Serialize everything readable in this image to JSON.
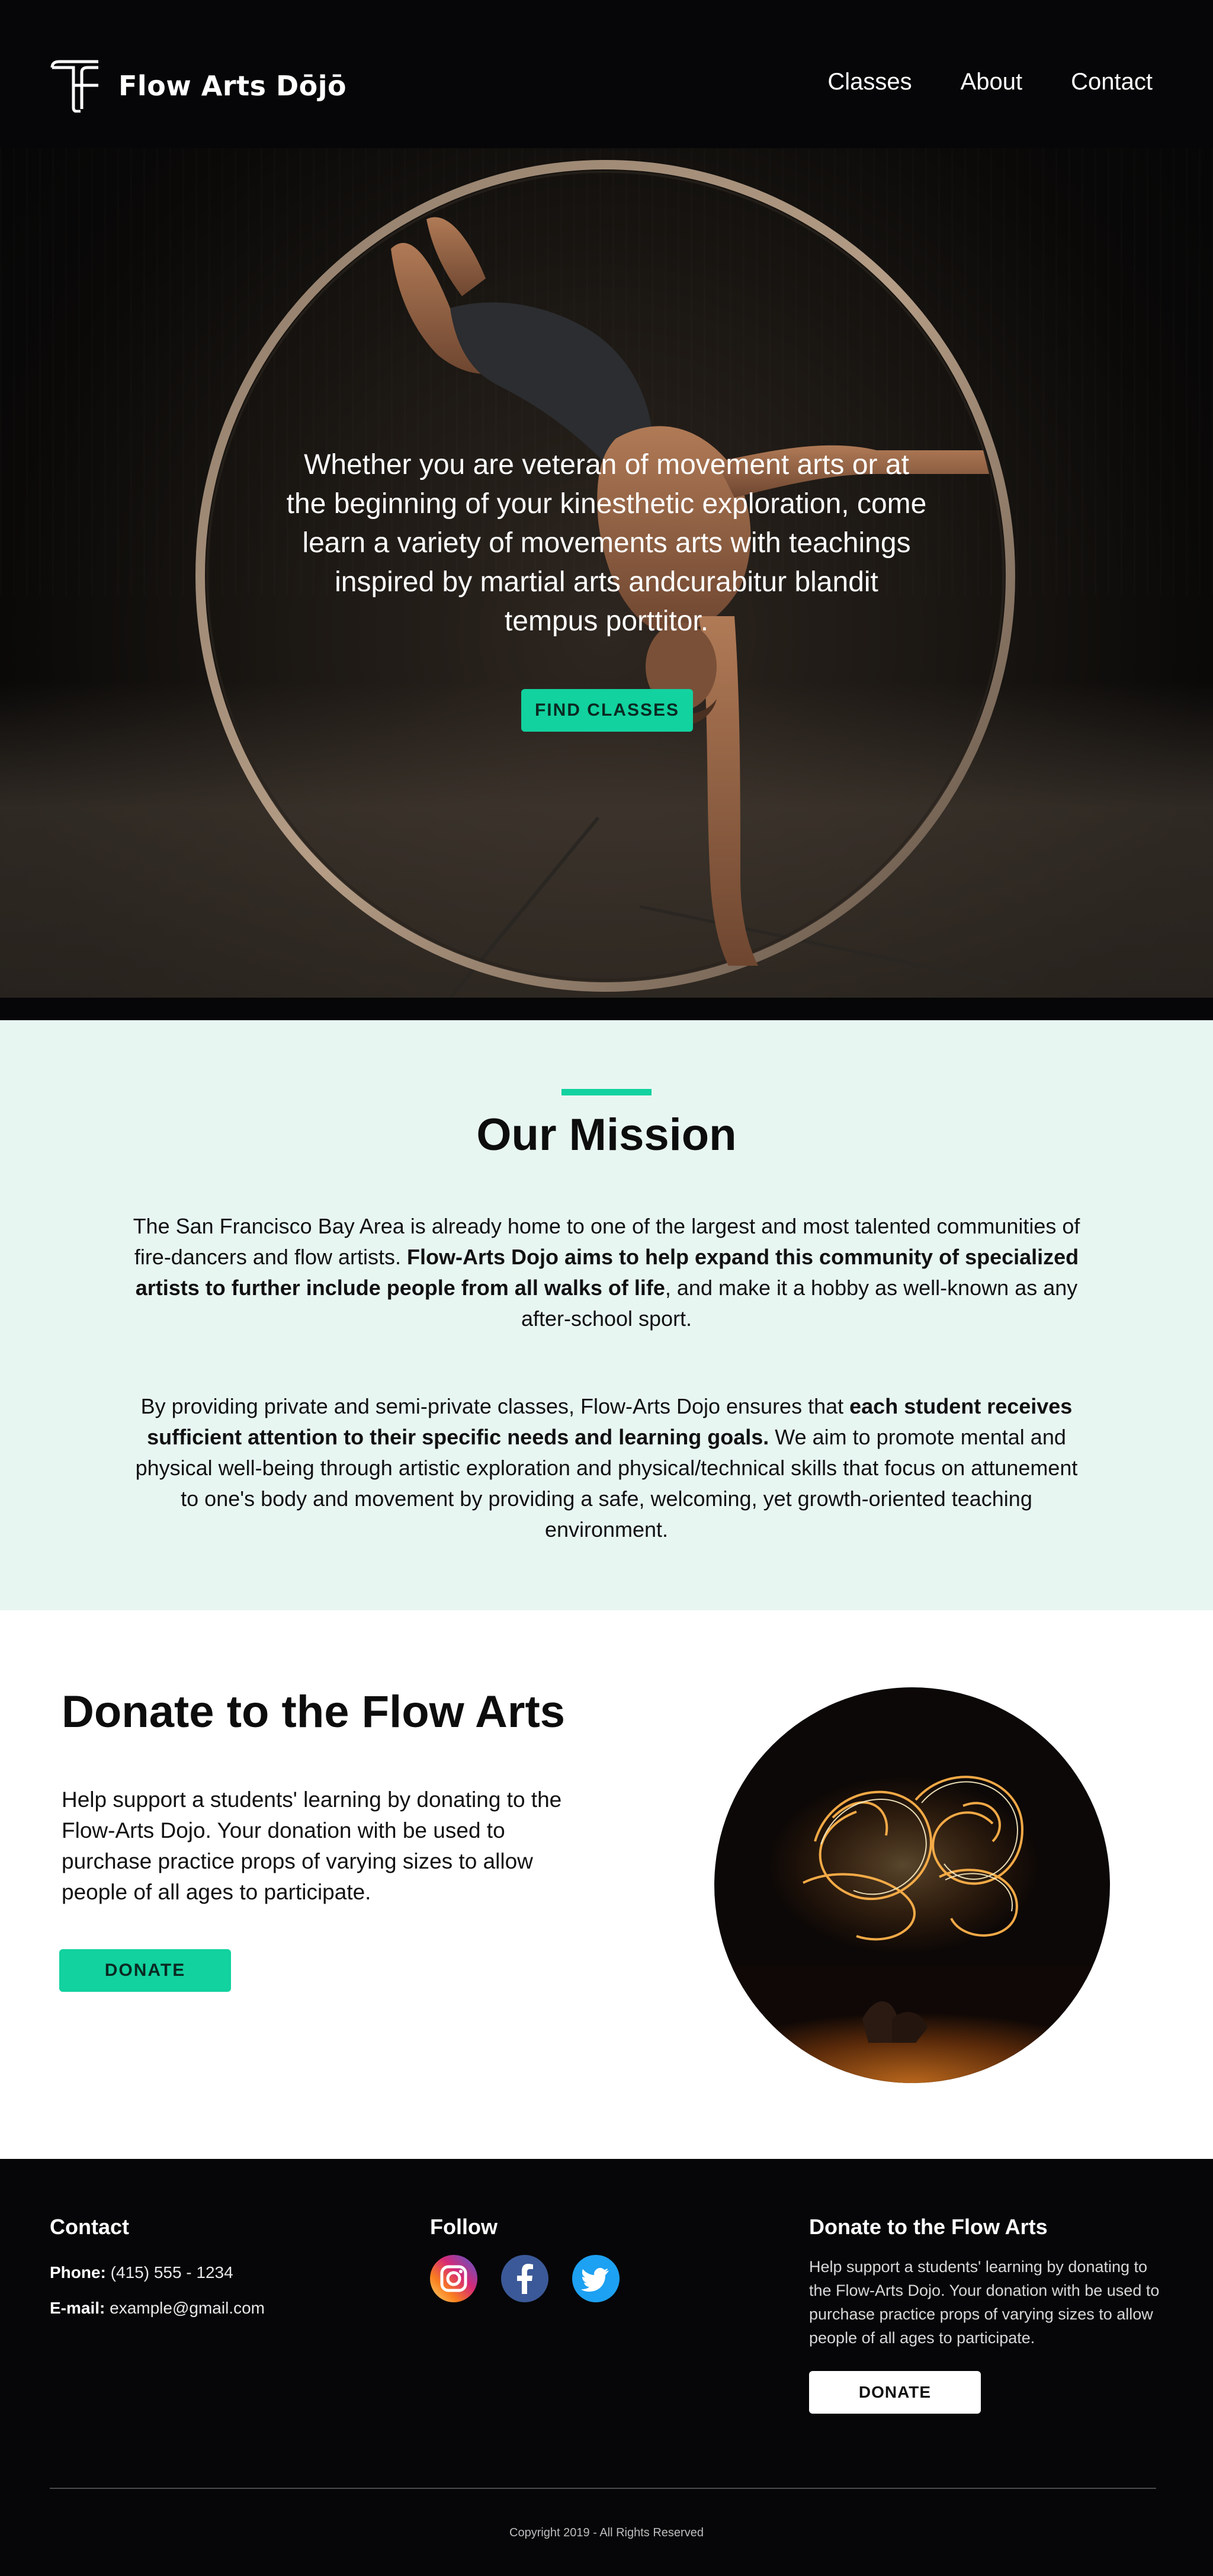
{
  "header": {
    "brand": "Flow Arts Dōjō",
    "nav": [
      "Classes",
      "About",
      "Contact"
    ]
  },
  "hero": {
    "tagline": "Whether you are veteran of movement arts or at the beginning of your kinesthetic exploration, come learn a variety of movements arts with teachings inspired by martial arts andcurabitur blandit tempus porttitor.",
    "cta_label": "FIND CLASSES"
  },
  "mission": {
    "title": "Our Mission",
    "p1_a": "The San Francisco Bay Area is already home to one of the largest and most talented communities of fire-dancers and flow artists. ",
    "p1_b": "Flow-Arts Dojo aims to help expand this community of specialized artists to further include people from all walks of life",
    "p1_c": ", and make it a hobby as well-known as any after-school sport.",
    "p2_a": "By providing private and semi-private classes, Flow-Arts Dojo ensures that ",
    "p2_b": "each student receives sufficient attention to their specific needs and learning goals.",
    "p2_c": " We aim to promote mental and physical well-being through artistic exploration and physical/technical skills that focus on attunement to one's body and movement by providing a safe, welcoming, yet growth-oriented teaching environment."
  },
  "donate": {
    "title": "Donate to the Flow Arts",
    "text": "Help support a students' learning by donating to the Flow-Arts Dojo. Your donation with be used to purchase practice props of varying sizes to allow people of all ages to participate.",
    "button_label": "DONATE"
  },
  "footer": {
    "contact_title": "Contact",
    "phone_label": "Phone:",
    "phone": " (415) 555 - 1234",
    "email_label": "E-mail:",
    "email": " example@gmail.com",
    "follow_title": "Follow",
    "social_icons": [
      "instagram-icon",
      "facebook-icon",
      "twitter-icon"
    ],
    "donate_title": "Donate to the Flow Arts",
    "donate_text": "Help support a students' learning by donating to the Flow-Arts Dojo. Your donation with be used to purchase practice props of varying sizes to allow people of all ages to participate.",
    "donate_button": "DONATE",
    "copyright": "Copyright 2019 - All Rights Reserved"
  },
  "colors": {
    "accent": "#12d29f",
    "mission_bg": "#e8f6f2",
    "footer_bg": "#060608",
    "hero_bg": "#0a0908"
  }
}
